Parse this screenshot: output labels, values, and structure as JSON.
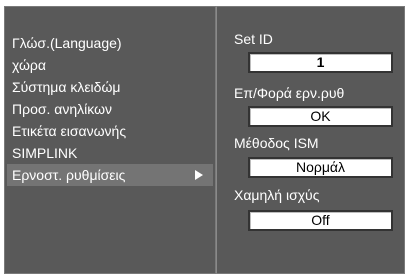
{
  "menu": {
    "items": [
      {
        "label": "Γλώσ.(Language)"
      },
      {
        "label": "χώρα"
      },
      {
        "label": "Σύστημα κλειδώμ"
      },
      {
        "label": "Προσ. ανηλίκων"
      },
      {
        "label": "Ετικέτα εισανωνής"
      },
      {
        "label": "SIMPLINK"
      },
      {
        "label": "Ερνοστ. ρυθμίσεις"
      }
    ],
    "selected_index": 6,
    "selected_arrow_icon": "arrow-right-icon"
  },
  "settings": {
    "set_id": {
      "label": "Set ID",
      "value": "1"
    },
    "power_on_status": {
      "label": "Επ/Φορά ερν.ρυθ",
      "value": "OK"
    },
    "ism_method": {
      "label": "Μέθοδος ISM",
      "value": "Νορμάλ"
    },
    "low_power": {
      "label": "Χαμηλή ισχύς",
      "value": "Off"
    }
  },
  "colors": {
    "panel_bg": "#595959",
    "selected_bg": "#747474",
    "text": "#ffffff",
    "value_box_bg": "#ffffff"
  }
}
